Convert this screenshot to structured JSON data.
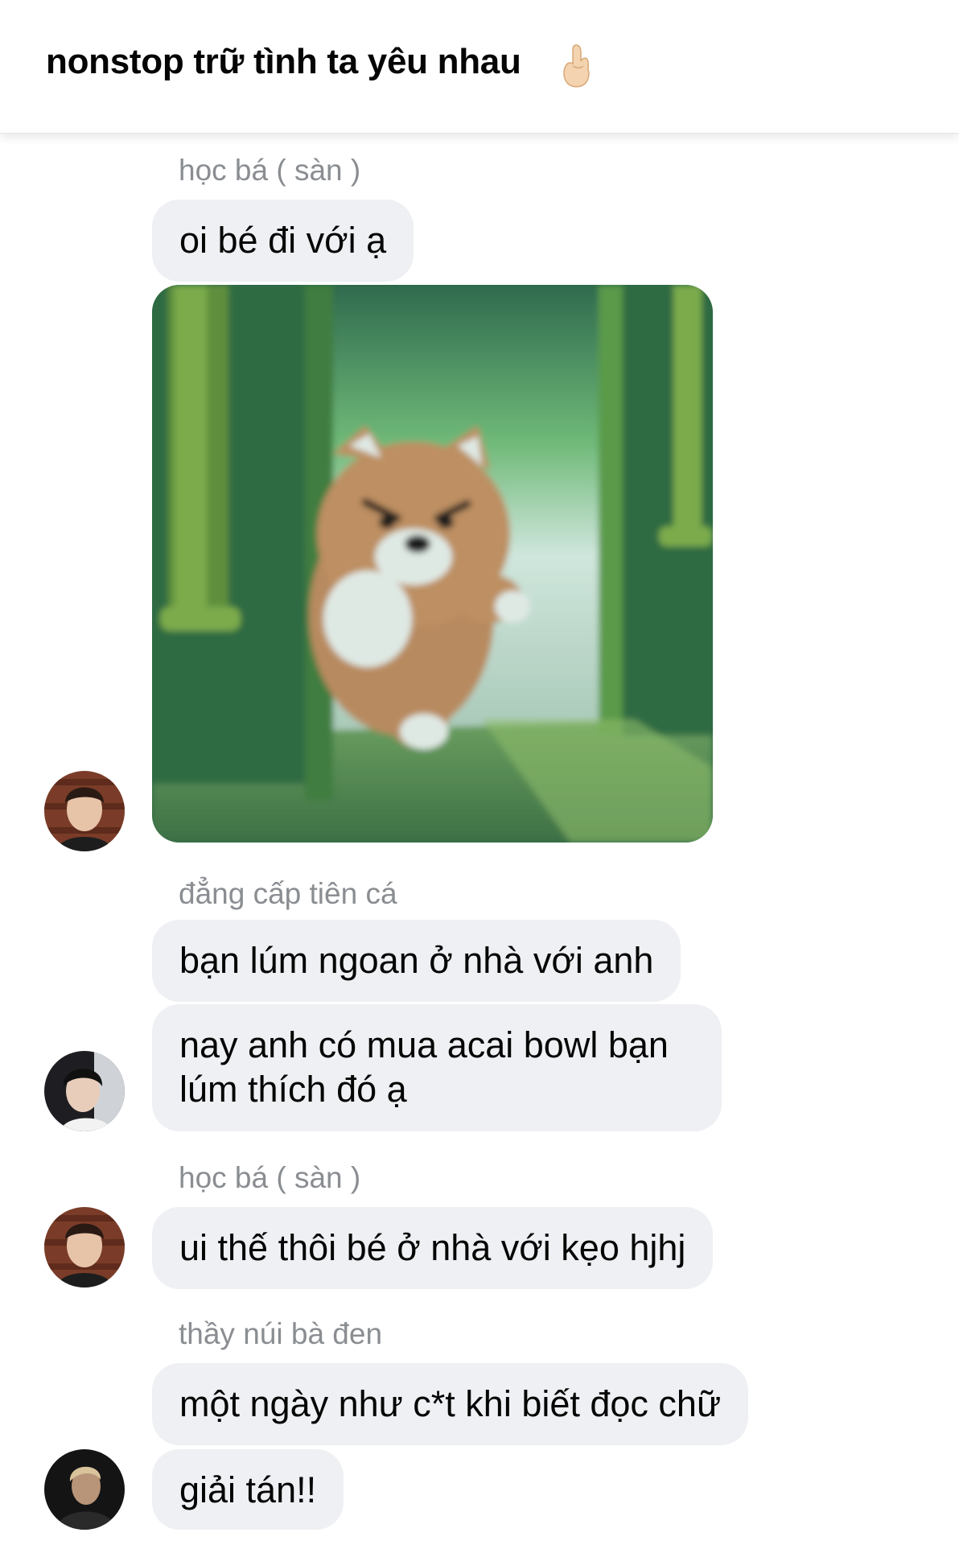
{
  "chat": {
    "title": "nonstop trữ tình ta yêu nhau",
    "title_emoji_icon": "pinky-promise-hand-icon"
  },
  "messages": [
    {
      "sender": "học bá ( sàn )",
      "texts": [
        "oi bé đi với ạ"
      ],
      "has_sticker": true,
      "sticker_icon": "angry-bear-at-door-sticker"
    },
    {
      "sender": "đẳng cấp tiên cá",
      "texts": [
        "bạn lúm ngoan ở nhà với anh",
        "nay anh có mua acai bowl bạn lúm thích đó ạ"
      ]
    },
    {
      "sender": "học bá ( sàn )",
      "texts": [
        "ui thế thôi bé ở nhà với kẹo hjhj"
      ]
    },
    {
      "sender": "thầy núi bà đen",
      "texts": [
        "một ngày như c*t khi biết đọc chữ",
        "giải tán!!"
      ]
    }
  ],
  "colors": {
    "bubble_bg": "#eff0f3",
    "sender_text": "#8a8d91",
    "text": "#050505"
  }
}
